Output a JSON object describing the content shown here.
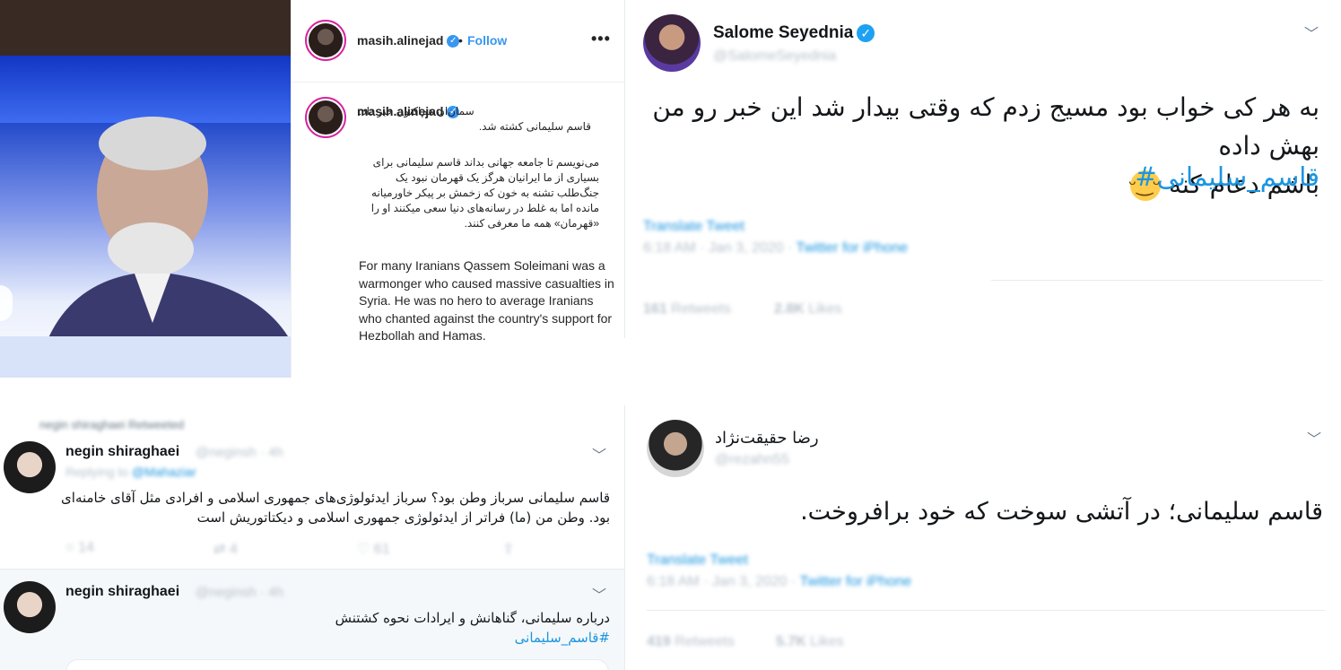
{
  "instagram": {
    "username": "masih.alinejad",
    "follow_label": "Follow",
    "more_icon": "more-dots-icon",
    "caption_fa": [
      "سمان‌ان هم‌اکنون خبر داد:",
      "قاسم سلیمانی کشته شد."
    ],
    "caption_fa_body": [
      "می‌نویسم تا جامعه جهانی بداند قاسم سلیمانی برای",
      "بسیاری از ما ایرانیان هرگز یک قهرمان نبود یک",
      "جنگ‌طلب تشنه به خون که زخمش بر پیکر خاورمیانه",
      "مانده اما به غلط در رسانه‌های دنیا سعی میکنند او را",
      "«قهرمان» همه ما معرفی کنند."
    ],
    "caption_en": "For many Iranians Qassem Soleimani was a warmonger who caused massive casualties in Syria. He was no hero to average Iranians who chanted against the country's support for Hezbollah and Hamas."
  },
  "salome": {
    "name": "Salome Seyednia",
    "handle": "@SalomeSeyednia",
    "text_line1": "به هر کی خواب بود مسیج زدم که وقتی بیدار شد این خبر رو من بهش داده",
    "text_line2": "باشم دعام کنه",
    "hashtag": "#قاسم_سلیمانی",
    "translate": "Translate Tweet",
    "time": "6:18 AM · Jan 3, 2020 · ",
    "source": "Twitter for iPhone",
    "retweets_count": "161",
    "retweets_label": "Retweets",
    "likes_count": "2.8K",
    "likes_label": "Likes"
  },
  "negin": {
    "retweeted_by": "negin shiraghaei Retweeted",
    "tweet1": {
      "name": "negin shiraghaei",
      "handle": "@neginsh · 4h",
      "replying": "Replying to ",
      "replying_handle": "@Mahaziar",
      "line1": "قاسم سلیمانی سرباز وطن بود؟ سرباز ایدئولوژی‌های جمهوری اسلامی و افرادی مثل آقای خامنه‌ای",
      "line2": "بود. وطن من (ما) فراتر از ایدئولوژی جمهوری اسلامی و دیکتاتوریش است",
      "reply_count": "14",
      "retweet_count": "4",
      "like_count": "61"
    },
    "tweet2": {
      "name": "negin shiraghaei",
      "handle": "@neginsh · 4h",
      "line1": "درباره سلیمانی، گناهانش و ایرادات نحوه کشتنش",
      "hashtag": "#قاسم_سلیمانی"
    }
  },
  "reza": {
    "name": "رضا حقیقت‌نژاد",
    "handle": "@rezahn55",
    "text": "قاسم سلیمانی؛ در آتشی سوخت که خود برافروخت.",
    "translate": "Translate Tweet",
    "time": "6:18 AM · Jan 3, 2020 · ",
    "source": "Twitter for iPhone",
    "retweets_count": "419",
    "retweets_label": "Retweets",
    "likes_count": "5.7K",
    "likes_label": "Likes"
  }
}
